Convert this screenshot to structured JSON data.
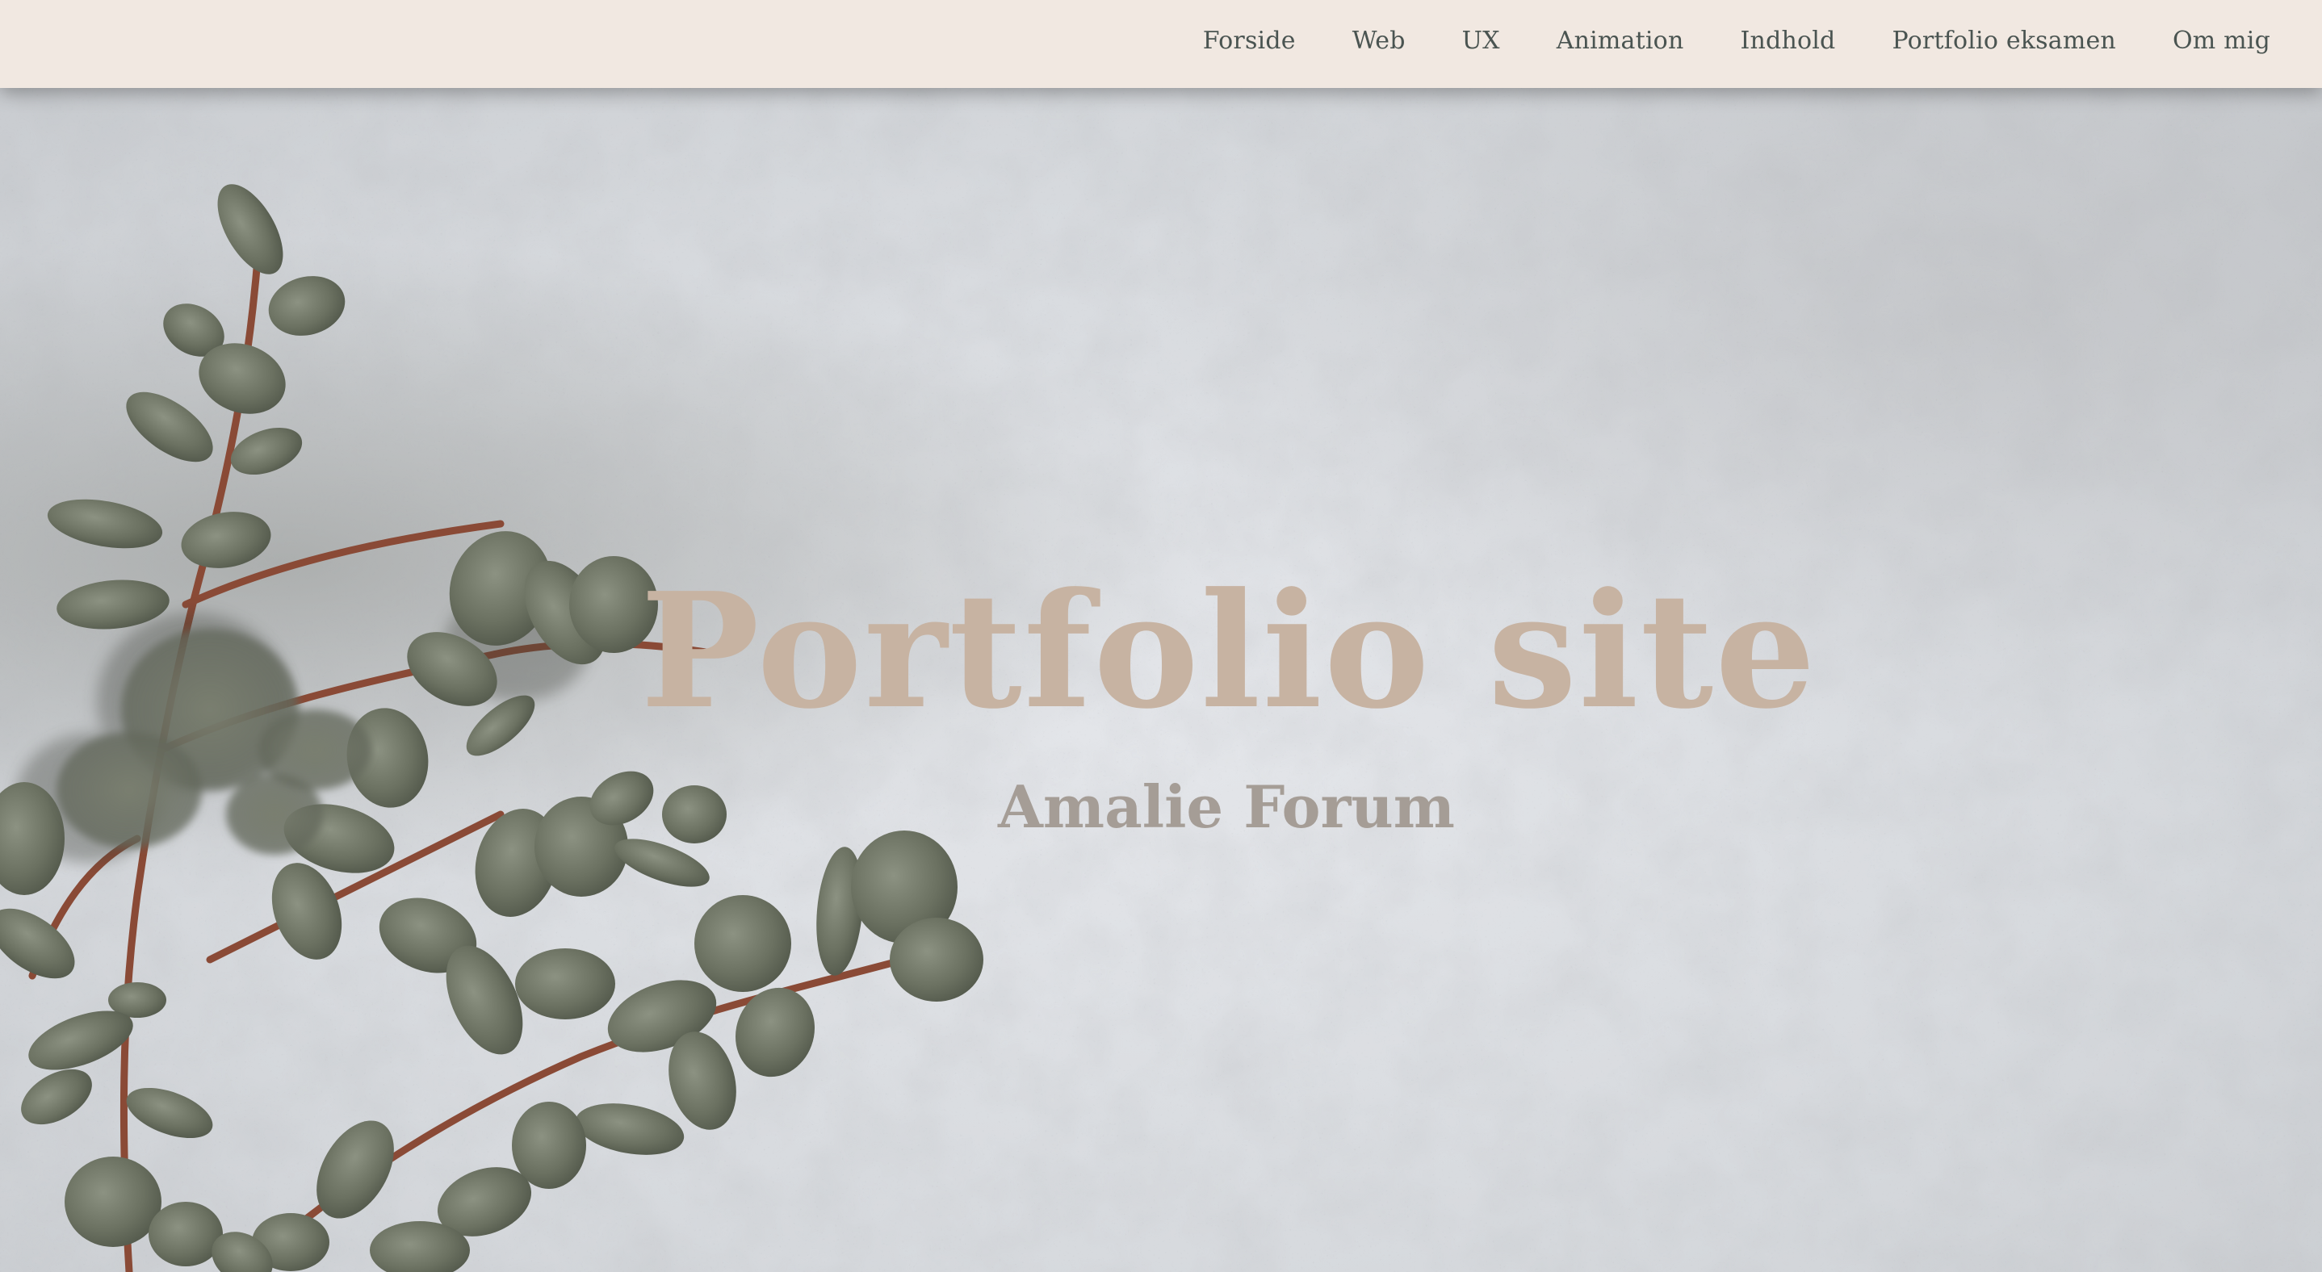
{
  "nav": {
    "items": [
      {
        "label": "Forside"
      },
      {
        "label": "Web"
      },
      {
        "label": "UX"
      },
      {
        "label": "Animation"
      },
      {
        "label": "Indhold"
      },
      {
        "label": "Portfolio eksamen"
      },
      {
        "label": "Om mig"
      }
    ]
  },
  "hero": {
    "title": "Portfolio site",
    "subtitle": "Amalie Forum",
    "background_image": "concrete-texture-with-eucalyptus-branch"
  },
  "colors": {
    "nav_background": "#f1e8e1",
    "nav_text": "#4a5451",
    "title": "#c7b3a2",
    "subtitle": "#a59d96",
    "leaf": "#6b7161",
    "stem": "#8a4a36"
  }
}
